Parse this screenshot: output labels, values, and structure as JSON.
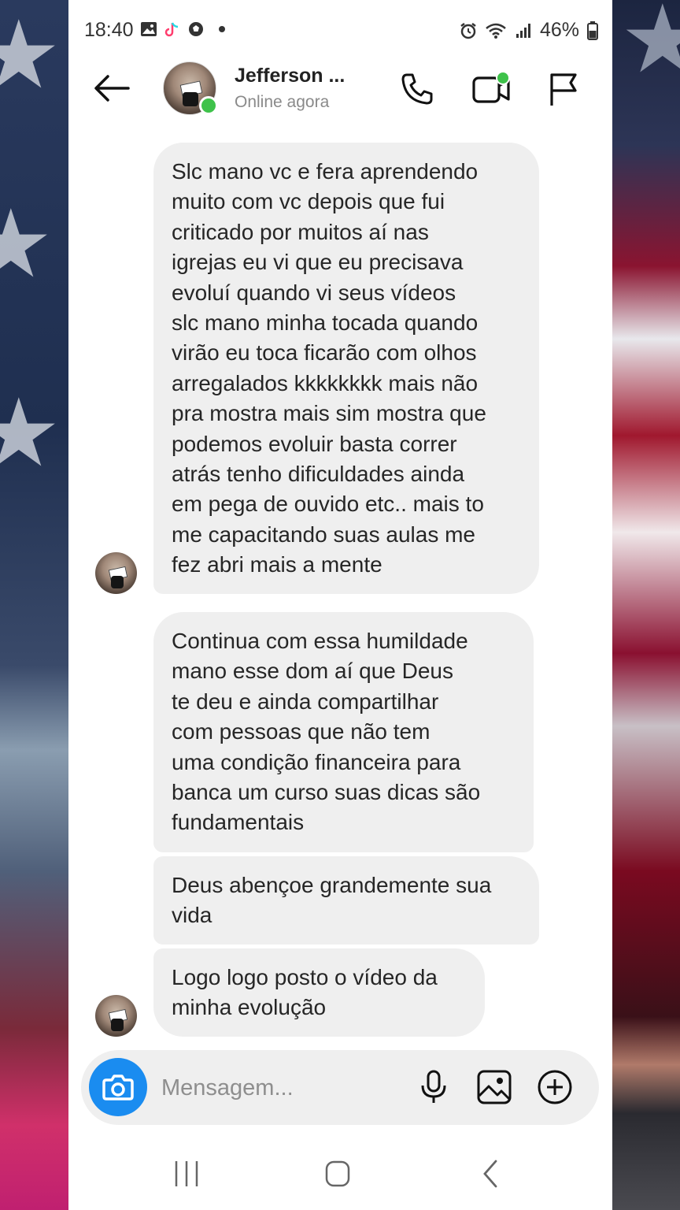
{
  "status_bar": {
    "time": "18:40",
    "battery": "46%",
    "left_icons": [
      "gallery-icon",
      "tiktok-icon",
      "soccer-ball-icon",
      "dot-icon"
    ],
    "right_icons": [
      "alarm-icon",
      "wifi-icon",
      "signal-icon",
      "battery-icon"
    ]
  },
  "header": {
    "contact_name": "Jefferson ...",
    "contact_status": "Online agora",
    "icons": [
      "back-arrow-icon",
      "phone-icon",
      "video-call-icon",
      "flag-icon"
    ],
    "online_color": "#3ec24a",
    "video_badge_color": "#3ec24a"
  },
  "messages": [
    {
      "text": "Slc mano vc e fera aprendendo\nmuito com vc depois que fui\ncriticado por muitos aí nas\nigrejas eu vi que eu precisava\nevoluí quando vi seus vídeos\nslc mano minha tocada quando\nvirão eu toca ficarão com olhos\narregalados kkkkkkkk mais não\npra mostra mais sim mostra que\npodemos evoluir basta correr\natrás tenho dificuldades ainda\nem pega de ouvido etc.. mais to\nme capacitando suas aulas me\nfez abri mais a mente"
    },
    {
      "text": "Continua com essa humildade\nmano esse dom aí que Deus\nte deu e ainda compartilhar\ncom pessoas que não tem\numa condição financeira para\nbanca um curso suas dicas são\nfundamentais"
    },
    {
      "text": "Deus abençoe grandemente sua\nvida"
    },
    {
      "text": "Logo logo posto o vídeo da\nminha evolução"
    }
  ],
  "composer": {
    "placeholder": "Mensagem...",
    "camera_color": "#1a8cf0",
    "icons": [
      "camera-icon",
      "microphone-icon",
      "image-icon",
      "plus-circle-icon"
    ]
  },
  "nav_bar": {
    "icons": [
      "recent-apps-icon",
      "home-icon",
      "back-icon"
    ]
  },
  "colors": {
    "bubble_bg": "#efefef",
    "text": "#262626",
    "muted": "#8a8a8a"
  }
}
